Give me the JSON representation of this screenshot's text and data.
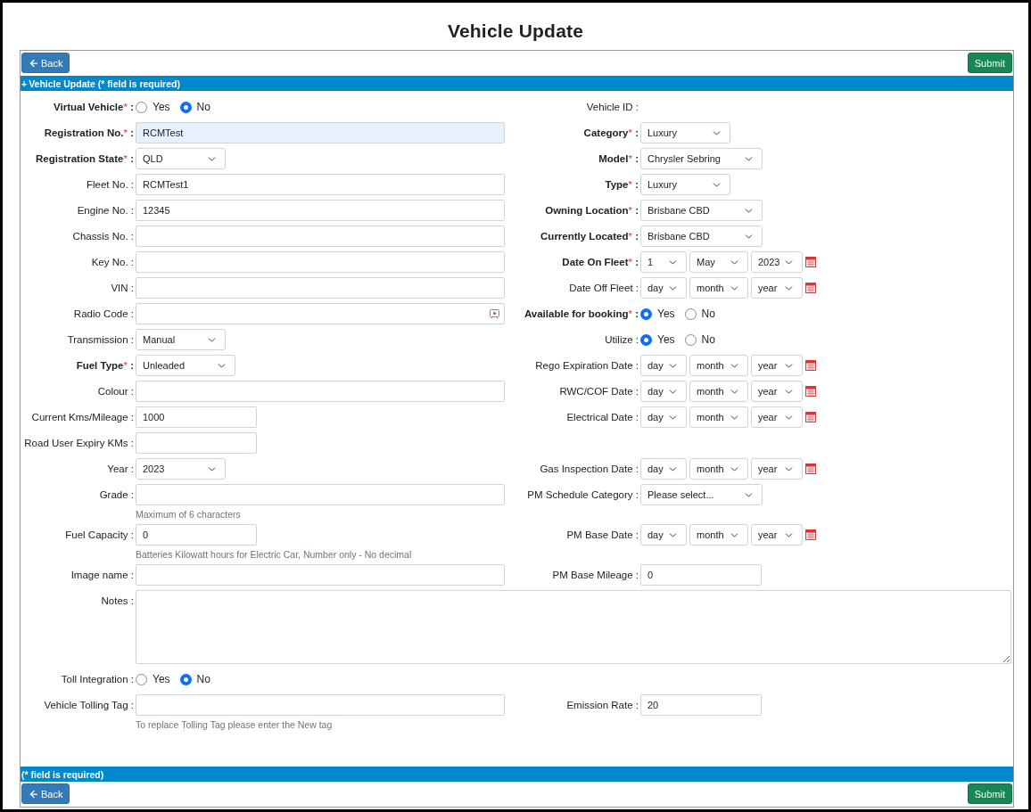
{
  "page": {
    "title": "Vehicle Update"
  },
  "toolbar_top": {
    "back": "Back",
    "submit": "Submit"
  },
  "header_bar": {
    "icon": "+",
    "text": "Vehicle Update (* field is required)"
  },
  "form": {
    "rows": [
      {
        "left": {
          "label": "Virtual Vehicle",
          "mark": "*",
          "sep": ":",
          "kind": "radio",
          "options": [
            {
              "label": "Yes",
              "selected": false
            },
            {
              "label": "No",
              "selected": true
            }
          ]
        },
        "right": {
          "label": "Vehicle ID",
          "sep": ":",
          "kind": "static"
        }
      },
      {
        "left": {
          "label": "Registration No.",
          "mark": "*",
          "sep": ":",
          "kind": "text",
          "value": "RCMTest",
          "autofilled": true
        },
        "right": {
          "label": "Category",
          "mark": "*",
          "sep": ":",
          "kind": "select",
          "value": "Luxury"
        }
      },
      {
        "left": {
          "label": "Registration State",
          "mark": "*",
          "sep": ":",
          "kind": "select",
          "value": "QLD"
        },
        "right": {
          "label": "Model",
          "mark": "*",
          "sep": ":",
          "kind": "select",
          "value": "Chrysler Sebring"
        }
      },
      {
        "left": {
          "label": "Fleet No.",
          "sep": ":",
          "kind": "text",
          "value": "RCMTest1"
        },
        "right": {
          "label": "Type",
          "mark": "*",
          "sep": ":",
          "kind": "select",
          "value": "Luxury"
        }
      },
      {
        "left": {
          "label": "Engine No.",
          "sep": ":",
          "kind": "text",
          "value": "12345"
        },
        "right": {
          "label": "Owning Location",
          "mark": "*",
          "sep": ":",
          "kind": "select",
          "value": "Brisbane CBD"
        }
      },
      {
        "left": {
          "label": "Chassis No.",
          "sep": ":",
          "kind": "text"
        },
        "right": {
          "label": "Currently Located",
          "mark": "*",
          "sep": ":",
          "kind": "select",
          "value": "Brisbane CBD"
        }
      },
      {
        "left": {
          "label": "Key No.",
          "sep": ":",
          "kind": "text"
        },
        "right": {
          "label": "Date On Fleet",
          "mark": "*",
          "sep": ":",
          "kind": "date",
          "day": "1",
          "month": "May",
          "year": "2023"
        }
      },
      {
        "left": {
          "label": "VIN",
          "sep": ":",
          "kind": "text"
        },
        "right": {
          "label": "Date Off Fleet",
          "sep": ":",
          "kind": "date",
          "day": "day",
          "month": "month",
          "year": "year"
        }
      },
      {
        "left": {
          "label": "Radio Code",
          "sep": ":",
          "kind": "text",
          "has_icon": true
        },
        "right": {
          "label": "Available for booking",
          "mark": "*",
          "sep": ":",
          "kind": "radio",
          "options": [
            {
              "label": "Yes",
              "selected": true
            },
            {
              "label": "No",
              "selected": false
            }
          ]
        }
      },
      {
        "left": {
          "label": "Transmission",
          "sep": ":",
          "kind": "select",
          "value": "Manual"
        },
        "right": {
          "label": "Utilize",
          "sep": ":",
          "kind": "radio",
          "options": [
            {
              "label": "Yes",
              "selected": true
            },
            {
              "label": "No",
              "selected": false
            }
          ]
        }
      },
      {
        "left": {
          "label": "Fuel Type",
          "mark": "*",
          "sep": ":",
          "kind": "select",
          "value": "Unleaded"
        },
        "right": {
          "label": "Rego Expiration Date",
          "sep": ":",
          "kind": "date",
          "day": "day",
          "month": "month",
          "year": "year"
        }
      },
      {
        "left": {
          "label": "Colour",
          "sep": ":",
          "kind": "text"
        },
        "right": {
          "label": "RWC/COF Date",
          "sep": ":",
          "kind": "date",
          "day": "day",
          "month": "month",
          "year": "year"
        }
      },
      {
        "left": {
          "label": "Current Kms/Mileage",
          "sep": ":",
          "kind": "number",
          "value": "1000"
        },
        "right": {
          "label": "Electrical Date",
          "sep": ":",
          "kind": "date",
          "day": "day",
          "month": "month",
          "year": "year"
        }
      },
      {
        "left": {
          "label": "Road User Expiry KMs",
          "sep": ":",
          "kind": "number"
        }
      },
      {
        "left": {
          "label": "Year",
          "sep": ":",
          "kind": "select",
          "value": "2023"
        },
        "right": {
          "label": "Gas Inspection Date",
          "sep": ":",
          "kind": "date",
          "day": "day",
          "month": "month",
          "year": "year"
        }
      },
      {
        "left": {
          "label": "Grade",
          "sep": ":",
          "kind": "text",
          "help": "Maximum of 6 characters"
        },
        "right": {
          "label": "PM Schedule Category",
          "sep": ":",
          "kind": "select",
          "value": "Please select..."
        }
      },
      {
        "left": {
          "label": "Fuel Capacity",
          "sep": ":",
          "kind": "number",
          "value": "0",
          "help": "Batteries Kilowatt hours for Electric Car, Number only - No decimal"
        },
        "right": {
          "label": "PM Base Date",
          "sep": ":",
          "kind": "date",
          "day": "day",
          "month": "month",
          "year": "year"
        }
      },
      {
        "left": {
          "label": "Image name",
          "sep": ":",
          "kind": "text"
        },
        "right": {
          "label": "PM Base Mileage",
          "sep": ":",
          "kind": "number",
          "value": "0"
        }
      },
      {
        "wide": {
          "label": "Notes",
          "sep": ":",
          "kind": "textarea"
        }
      },
      {
        "left": {
          "label": "Toll Integration",
          "sep": ":",
          "kind": "radio",
          "options": [
            {
              "label": "Yes",
              "selected": false
            },
            {
              "label": "No",
              "selected": true
            }
          ]
        }
      },
      {
        "left": {
          "label": "Vehicle Tolling Tag",
          "sep": ":",
          "kind": "text",
          "help": "To replace Tolling Tag please enter the New tag"
        },
        "right": {
          "label": "Emission Rate",
          "sep": ":",
          "kind": "number",
          "value": "20"
        }
      }
    ]
  },
  "footer_bar": {
    "text": "(* field is required)"
  },
  "toolbar_bottom": {
    "back": "Back",
    "submit": "Submit"
  }
}
